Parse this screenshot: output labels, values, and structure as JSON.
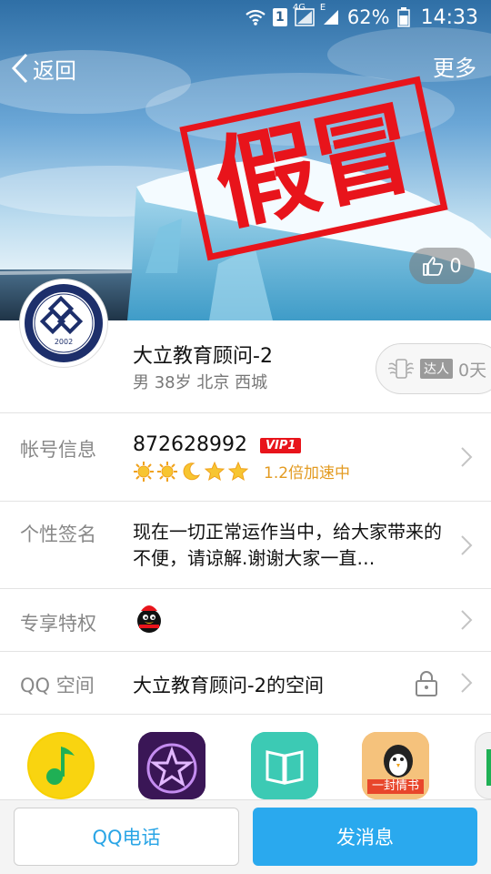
{
  "status_bar": {
    "sim": "1",
    "network": "4G",
    "network2": "E",
    "battery": "62%",
    "time": "14:33"
  },
  "nav": {
    "back_label": "返回",
    "more_label": "更多"
  },
  "cover": {
    "stamp_text": "假冒",
    "likes": "0"
  },
  "profile": {
    "avatar_text_top": "DALI EDUCATION",
    "avatar_year": "2002",
    "name": "大立教育顾问-2",
    "meta": "男 38岁 北京 西城",
    "expert_tag": "达人",
    "expert_days": "0天"
  },
  "rows": {
    "account": {
      "label": "帐号信息",
      "qq_number": "872628992",
      "vip": "VIP1",
      "speed": "1.2倍加速中"
    },
    "signature": {
      "label": "个性签名",
      "text": "现在一切正常运作当中，给大家带来的不便，请谅解.谢谢大家一直…"
    },
    "privilege": {
      "label": "专享特权"
    },
    "qzone": {
      "label": "QQ 空间",
      "value": "大立教育顾问-2的空间"
    }
  },
  "apps": {
    "love_letter_label": "一封情书"
  },
  "actions": {
    "call": "QQ电话",
    "message": "发消息"
  },
  "colors": {
    "accent": "#2aa9ee",
    "stamp": "#e8141b",
    "vip": "#e8141b",
    "speed": "#e39b22"
  }
}
